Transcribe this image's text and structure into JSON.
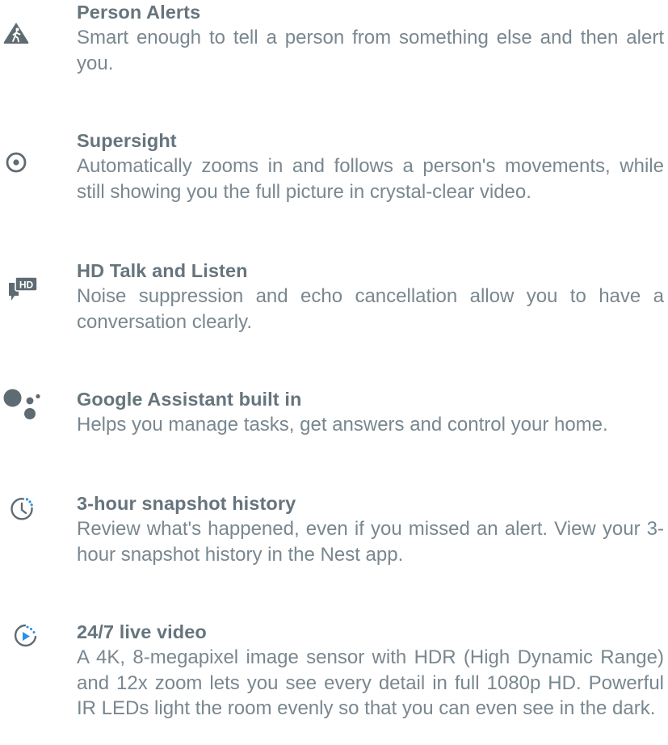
{
  "features": [
    {
      "icon": "walking-person-icon",
      "title": "Person Alerts",
      "description": "Smart enough to tell a person from something else and then alert you."
    },
    {
      "icon": "target-circle-icon",
      "title": "Supersight",
      "description": "Automatically zooms in and follows a person's movements, while still showing you the full picture in crystal-clear video."
    },
    {
      "icon": "hd-chat-bubble-icon",
      "icon_text": "HD",
      "title": "HD Talk and Listen",
      "description": "Noise suppression and echo cancellation allow you to have a conversation clearly."
    },
    {
      "icon": "google-assistant-dots-icon",
      "title": "Google Assistant built in",
      "description": "Helps you manage tasks, get answers and control your home."
    },
    {
      "icon": "clock-history-icon",
      "title": "3-hour snapshot history",
      "description": "Review what's happened, even if you missed an alert. View your 3-hour snapshot history in the Nest app."
    },
    {
      "icon": "live-video-play-icon",
      "title": "24/7 live video",
      "description": "A 4K, 8-megapixel image sensor with HDR (High Dynamic Range) and 12x zoom lets you see every detail in full 1080p HD. Powerful IR LEDs light the room evenly so that you can even see in the dark."
    }
  ],
  "colors": {
    "title": "#66747d",
    "text": "#79878f",
    "icon": "#5f6b72",
    "accent_blue": "#2f8fe0"
  }
}
